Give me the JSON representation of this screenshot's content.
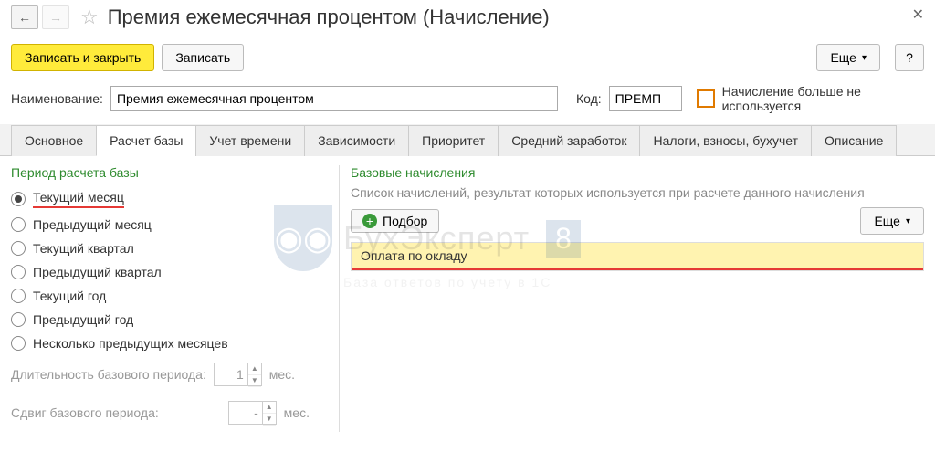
{
  "title": "Премия ежемесячная процентом (Начисление)",
  "toolbar": {
    "save_close": "Записать и закрыть",
    "save": "Записать",
    "more": "Еще",
    "help": "?"
  },
  "form": {
    "name_label": "Наименование:",
    "name_value": "Премия ежемесячная процентом",
    "code_label": "Код:",
    "code_value": "ПРЕМП",
    "disabled_label": "Начисление больше не используется"
  },
  "tabs": [
    "Основное",
    "Расчет базы",
    "Учет времени",
    "Зависимости",
    "Приоритет",
    "Средний заработок",
    "Налоги, взносы, бухучет",
    "Описание"
  ],
  "left": {
    "section": "Период расчета базы",
    "radios": [
      "Текущий месяц",
      "Предыдущий месяц",
      "Текущий квартал",
      "Предыдущий квартал",
      "Текущий год",
      "Предыдущий год",
      "Несколько предыдущих месяцев"
    ],
    "duration_label": "Длительность базового периода:",
    "duration_value": "1",
    "duration_unit": "мес.",
    "shift_label": "Сдвиг базового периода:",
    "shift_value": "-",
    "shift_unit": "мес."
  },
  "right": {
    "section": "Базовые начисления",
    "hint": "Список начислений, результат которых используется при расчете данного начисления",
    "podbor": "Подбор",
    "more": "Еще",
    "rows": [
      "Оплата по окладу"
    ]
  },
  "watermark": {
    "brand": "БухЭксперт",
    "num": "8",
    "owl": "◉◉",
    "sub": "База ответов по учету в 1С"
  }
}
